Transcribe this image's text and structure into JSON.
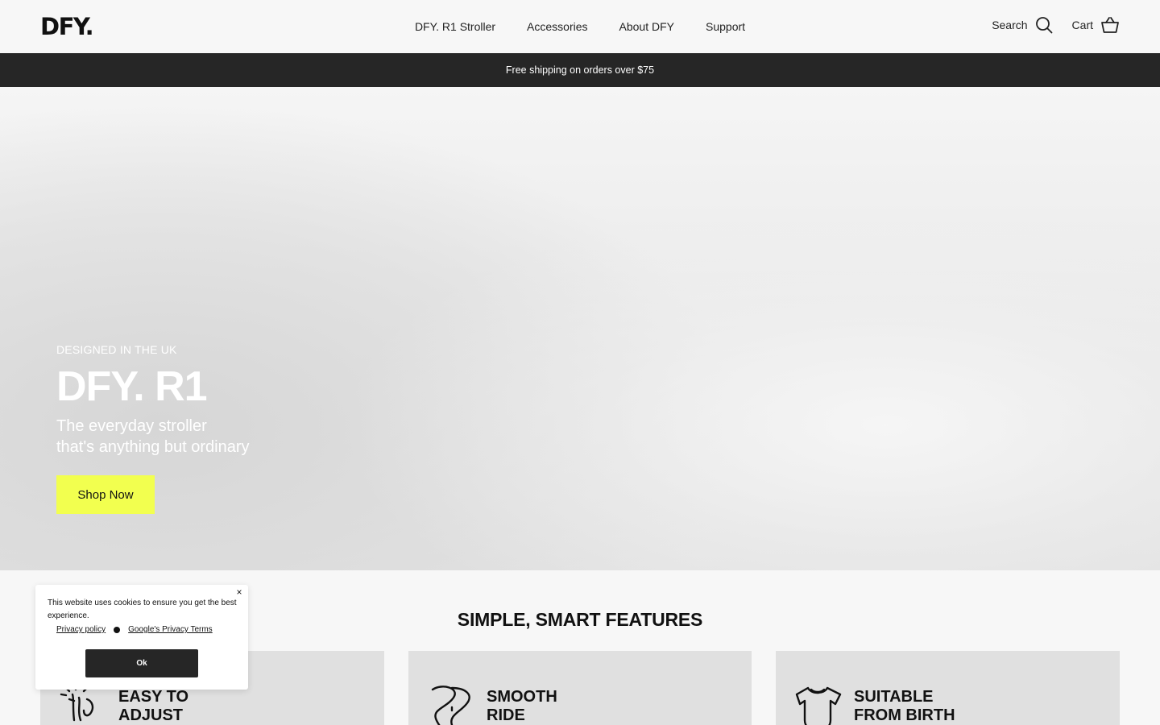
{
  "header": {
    "logo": "DFY.",
    "nav": [
      "DFY. R1 Stroller",
      "Accessories",
      "About DFY",
      "Support"
    ],
    "search_label": "Search",
    "cart_label": "Cart"
  },
  "announcement": "Free shipping on orders over $75",
  "hero": {
    "kicker": "DESIGNED IN THE UK",
    "title": "DFY. R1",
    "subtitle_line1": "The everyday stroller",
    "subtitle_line2": "that's anything but ordinary",
    "cta": "Shop Now",
    "cta_color": "#f2ff4f"
  },
  "features": {
    "title": "SIMPLE, SMART FEATURES",
    "cards": [
      {
        "line1": "EASY TO",
        "line2": "ADJUST",
        "icon": "adjust-hand-icon"
      },
      {
        "line1": "SMOOTH",
        "line2": "RIDE",
        "icon": "road-icon"
      },
      {
        "line1": "SUITABLE",
        "line2": "FROM BIRTH",
        "icon": "onesie-icon"
      }
    ]
  },
  "cookie": {
    "text": "This website uses cookies to ensure you get the best experience.",
    "privacy_link": "Privacy policy",
    "google_link": "Google's Privacy Terms",
    "ok_label": "Ok",
    "close_glyph": "×"
  }
}
